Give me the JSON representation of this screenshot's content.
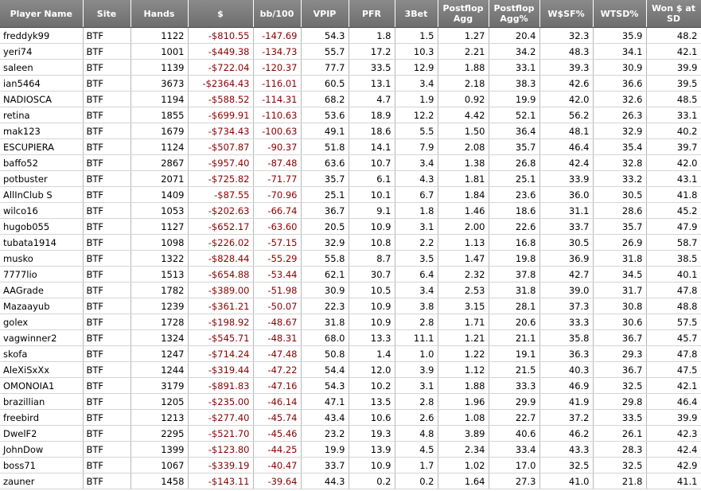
{
  "headers": [
    "Player Name",
    "Site",
    "Hands",
    "$",
    "bb/100",
    "VPIP",
    "PFR",
    "3Bet",
    "Postflop Agg",
    "Postflop Agg%",
    "W$SF%",
    "WTSD%",
    "Won $ at SD"
  ],
  "rows": [
    [
      "freddyk99",
      "BTF",
      "1122",
      "-$810.55",
      "-147.69",
      "54.3",
      "1.8",
      "1.5",
      "1.27",
      "20.4",
      "32.3",
      "35.9",
      "48.2"
    ],
    [
      "yeri74",
      "BTF",
      "1001",
      "-$449.38",
      "-134.73",
      "55.7",
      "17.2",
      "10.3",
      "2.21",
      "34.2",
      "48.3",
      "34.1",
      "42.1"
    ],
    [
      "saleen",
      "BTF",
      "1139",
      "-$722.04",
      "-120.37",
      "77.7",
      "33.5",
      "12.9",
      "1.88",
      "33.1",
      "39.3",
      "30.9",
      "39.9"
    ],
    [
      "ian5464",
      "BTF",
      "3673",
      "-$2364.43",
      "-116.01",
      "60.5",
      "13.1",
      "3.4",
      "2.18",
      "38.3",
      "42.6",
      "36.6",
      "39.5"
    ],
    [
      "NADIOSCA",
      "BTF",
      "1194",
      "-$588.52",
      "-114.31",
      "68.2",
      "4.7",
      "1.9",
      "0.92",
      "19.9",
      "42.0",
      "32.6",
      "48.5"
    ],
    [
      "retina",
      "BTF",
      "1855",
      "-$699.91",
      "-110.63",
      "53.6",
      "18.9",
      "12.2",
      "4.42",
      "52.1",
      "56.2",
      "26.3",
      "33.1"
    ],
    [
      "mak123",
      "BTF",
      "1679",
      "-$734.43",
      "-100.63",
      "49.1",
      "18.6",
      "5.5",
      "1.50",
      "36.4",
      "48.1",
      "32.9",
      "40.2"
    ],
    [
      "ESCUPIERA",
      "BTF",
      "1124",
      "-$507.87",
      "-90.37",
      "51.8",
      "14.1",
      "7.9",
      "2.08",
      "35.7",
      "46.4",
      "35.4",
      "39.7"
    ],
    [
      "baffo52",
      "BTF",
      "2867",
      "-$957.40",
      "-87.48",
      "63.6",
      "10.7",
      "3.4",
      "1.38",
      "26.8",
      "42.4",
      "32.8",
      "42.0"
    ],
    [
      "potbuster",
      "BTF",
      "2071",
      "-$725.82",
      "-71.77",
      "35.7",
      "6.1",
      "4.3",
      "1.81",
      "25.1",
      "33.9",
      "33.2",
      "43.1"
    ],
    [
      "AllInClub S",
      "BTF",
      "1409",
      "-$87.55",
      "-70.96",
      "25.1",
      "10.1",
      "6.7",
      "1.84",
      "23.6",
      "36.0",
      "30.5",
      "41.8"
    ],
    [
      "wilco16",
      "BTF",
      "1053",
      "-$202.63",
      "-66.74",
      "36.7",
      "9.1",
      "1.8",
      "1.46",
      "18.6",
      "31.1",
      "28.6",
      "45.2"
    ],
    [
      "hugob055",
      "BTF",
      "1127",
      "-$652.17",
      "-63.60",
      "20.5",
      "10.9",
      "3.1",
      "2.00",
      "22.6",
      "33.7",
      "35.7",
      "47.9"
    ],
    [
      "tubata1914",
      "BTF",
      "1098",
      "-$226.02",
      "-57.15",
      "32.9",
      "10.8",
      "2.2",
      "1.13",
      "16.8",
      "30.5",
      "26.9",
      "58.7"
    ],
    [
      "musko",
      "BTF",
      "1322",
      "-$828.44",
      "-55.29",
      "55.8",
      "8.7",
      "3.5",
      "1.47",
      "19.8",
      "36.9",
      "31.8",
      "38.5"
    ],
    [
      "7777lio",
      "BTF",
      "1513",
      "-$654.88",
      "-53.44",
      "62.1",
      "30.7",
      "6.4",
      "2.32",
      "37.8",
      "42.7",
      "34.5",
      "40.1"
    ],
    [
      "AAGrade",
      "BTF",
      "1782",
      "-$389.00",
      "-51.98",
      "30.9",
      "10.5",
      "3.4",
      "2.53",
      "31.8",
      "39.0",
      "31.7",
      "47.8"
    ],
    [
      "Mazaayub",
      "BTF",
      "1239",
      "-$361.21",
      "-50.07",
      "22.3",
      "10.9",
      "3.8",
      "3.15",
      "28.1",
      "37.3",
      "30.8",
      "48.8"
    ],
    [
      "golex",
      "BTF",
      "1728",
      "-$198.92",
      "-48.67",
      "31.8",
      "10.9",
      "2.8",
      "1.71",
      "20.6",
      "33.3",
      "30.6",
      "57.5"
    ],
    [
      "vagwinner2",
      "BTF",
      "1324",
      "-$545.71",
      "-48.31",
      "68.0",
      "13.3",
      "11.1",
      "1.21",
      "21.1",
      "35.8",
      "36.7",
      "45.7"
    ],
    [
      "skofa",
      "BTF",
      "1247",
      "-$714.24",
      "-47.48",
      "50.8",
      "1.4",
      "1.0",
      "1.22",
      "19.1",
      "36.3",
      "29.3",
      "47.8"
    ],
    [
      "AleXiSxXx",
      "BTF",
      "1244",
      "-$319.44",
      "-47.22",
      "54.4",
      "12.0",
      "3.9",
      "1.12",
      "21.5",
      "40.3",
      "36.7",
      "47.5"
    ],
    [
      "OMONOIA1",
      "BTF",
      "3179",
      "-$891.83",
      "-47.16",
      "54.3",
      "10.2",
      "3.1",
      "1.88",
      "33.3",
      "46.9",
      "32.5",
      "42.1"
    ],
    [
      "brazillian",
      "BTF",
      "1205",
      "-$235.00",
      "-46.14",
      "47.1",
      "13.5",
      "2.8",
      "1.96",
      "29.9",
      "41.9",
      "29.8",
      "46.4"
    ],
    [
      "freebird",
      "BTF",
      "1213",
      "-$277.40",
      "-45.74",
      "43.4",
      "10.6",
      "2.6",
      "1.08",
      "22.7",
      "37.2",
      "33.5",
      "39.9"
    ],
    [
      "DwelF2",
      "BTF",
      "2295",
      "-$521.70",
      "-45.46",
      "23.2",
      "19.3",
      "4.8",
      "3.89",
      "40.6",
      "46.2",
      "26.1",
      "42.3"
    ],
    [
      "JohnDow",
      "BTF",
      "1399",
      "-$123.80",
      "-44.25",
      "19.9",
      "13.9",
      "4.5",
      "2.34",
      "33.4",
      "43.3",
      "28.3",
      "42.4"
    ],
    [
      "boss71",
      "BTF",
      "1067",
      "-$339.19",
      "-40.47",
      "33.7",
      "10.9",
      "1.7",
      "1.02",
      "17.0",
      "32.5",
      "32.5",
      "42.9"
    ],
    [
      "zauner",
      "BTF",
      "1458",
      "-$143.11",
      "-39.64",
      "44.3",
      "0.2",
      "0.2",
      "1.64",
      "27.3",
      "41.0",
      "21.8",
      "41.1"
    ]
  ],
  "colors": {
    "header_bg": "#7a7a7a",
    "negative_text": "#8b0000"
  }
}
